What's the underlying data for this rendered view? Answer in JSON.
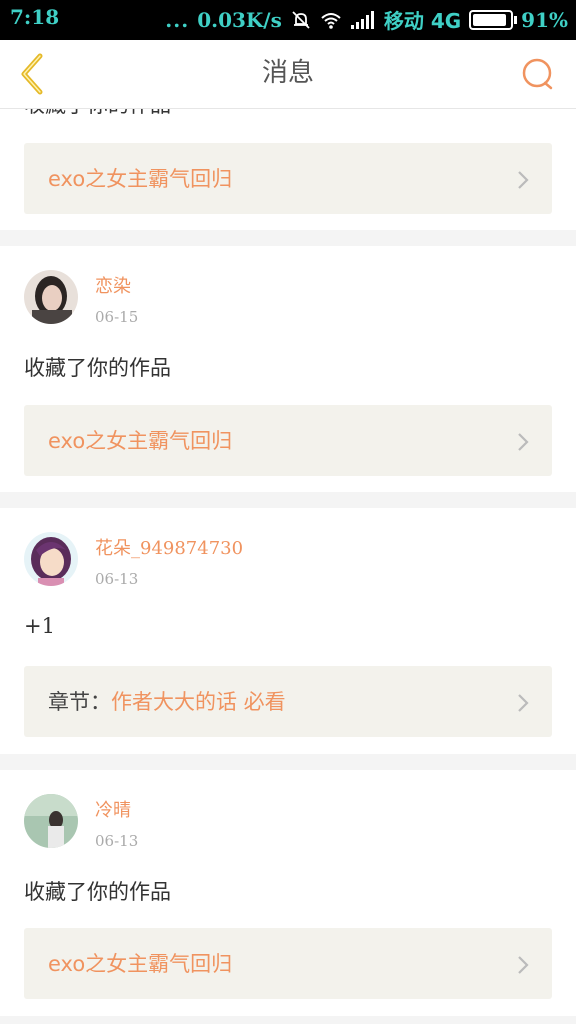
{
  "status_bar": {
    "time": "7:18",
    "dots": "...",
    "speed": "0.03K/s",
    "carrier": "移动 4G",
    "battery": "91%",
    "battery_level": 0.91
  },
  "nav": {
    "title": "消息",
    "back_icon": "back-chevron-icon",
    "search_icon": "search-icon"
  },
  "top_partial": {
    "message": "收藏了你的作品",
    "link_title": "exo之女主霸气回归"
  },
  "notifications": [
    {
      "username": "恋染",
      "date": "06-15",
      "message": "收藏了你的作品",
      "link_prefix": "",
      "link_title": "exo之女主霸气回归"
    },
    {
      "username": "花朵_949874730",
      "date": "06-13",
      "message": "+1",
      "link_prefix": "章节：",
      "link_title": "作者大大的话 必看"
    },
    {
      "username": "冷晴",
      "date": "06-13",
      "message": "收藏了你的作品",
      "link_prefix": "",
      "link_title": "exo之女主霸气回归"
    }
  ],
  "colors": {
    "accent": "#f0935f",
    "back_icon": "#e5b928",
    "status_text": "#3fd0c6",
    "link_bg": "#f3f2ec"
  }
}
